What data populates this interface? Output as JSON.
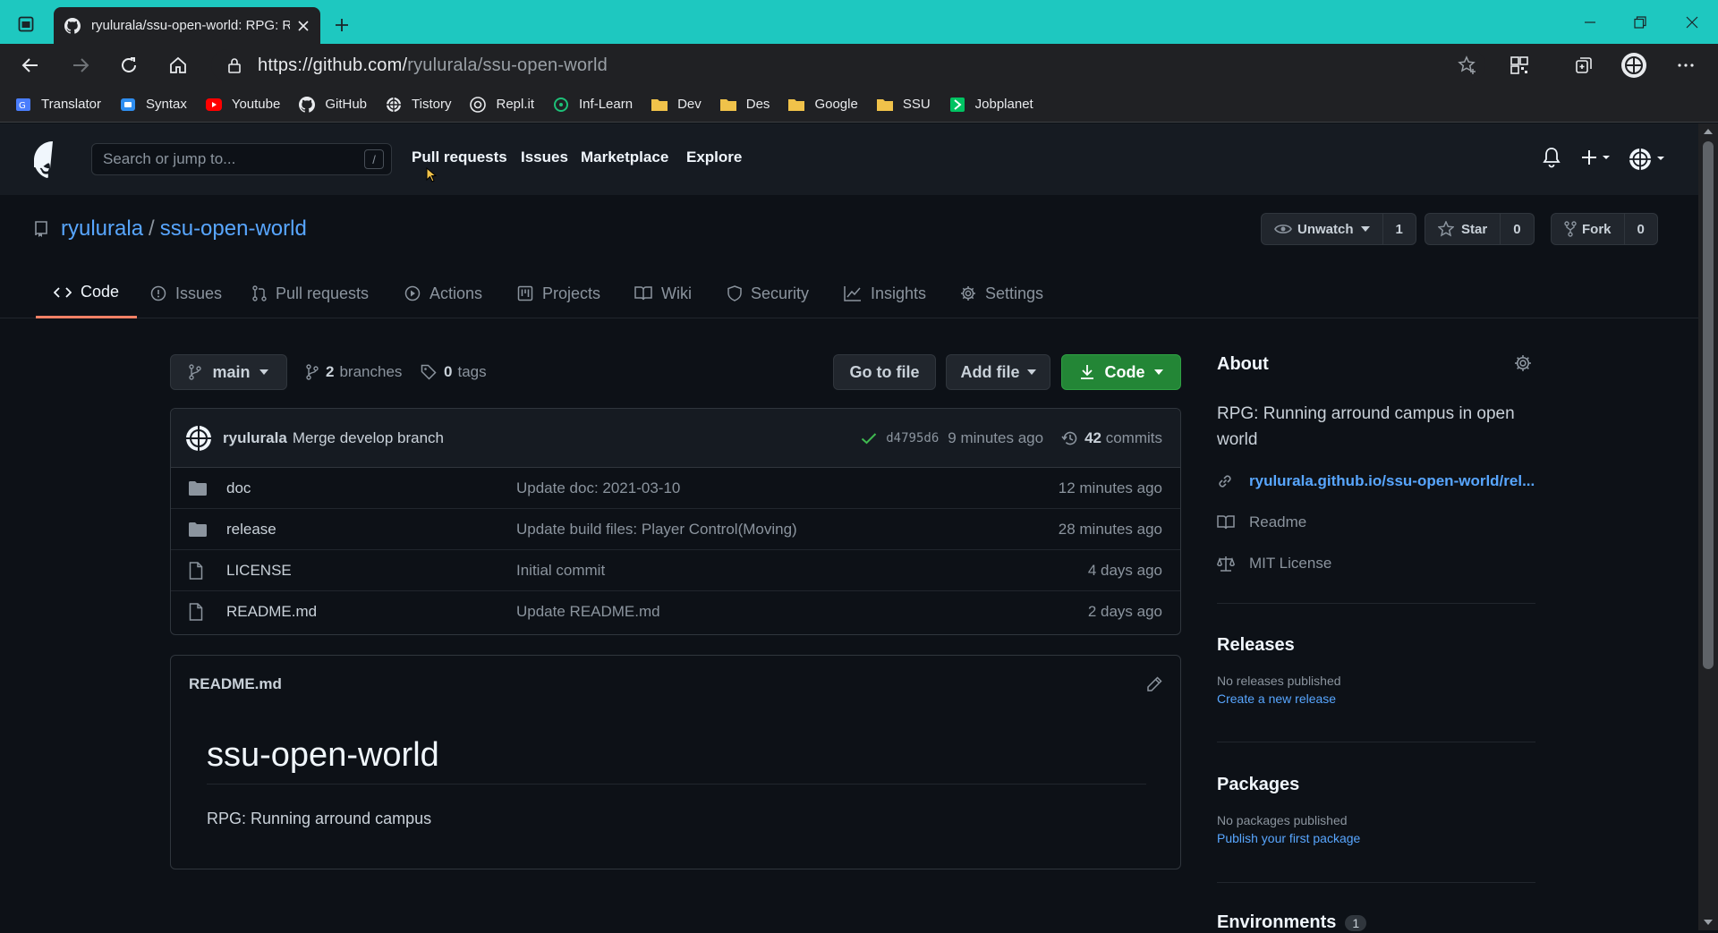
{
  "browser": {
    "tab_title": "ryulurala/ssu-open-world: RPG: Running arround campus",
    "url_host": "https://github.com/",
    "url_path": "ryulurala/ssu-open-world",
    "bookmarks": [
      "Translator",
      "Syntax",
      "Youtube",
      "GitHub",
      "Tistory",
      "Repl.it",
      "Inf-Learn",
      "Dev",
      "Des",
      "Google",
      "SSU",
      "Jobplanet"
    ]
  },
  "github_header": {
    "search_placeholder": "Search or jump to...",
    "search_shortcut": "/",
    "nav": [
      "Pull requests",
      "Issues",
      "Marketplace",
      "Explore"
    ]
  },
  "repo": {
    "owner": "ryulurala",
    "separator": "/",
    "name": "ssu-open-world",
    "watch_label": "Unwatch",
    "watch_count": "1",
    "star_label": "Star",
    "star_count": "0",
    "fork_label": "Fork",
    "fork_count": "0"
  },
  "repo_tabs": [
    "Code",
    "Issues",
    "Pull requests",
    "Actions",
    "Projects",
    "Wiki",
    "Security",
    "Insights",
    "Settings"
  ],
  "toolbar": {
    "branch": "main",
    "branches_count": "2",
    "branches_label": "branches",
    "tags_count": "0",
    "tags_label": "tags",
    "go_to_file": "Go to file",
    "add_file": "Add file",
    "code": "Code"
  },
  "latest_commit": {
    "author": "ryulurala",
    "message": "Merge develop branch",
    "sha": "d4795d6",
    "time": "9 minutes ago",
    "commits_count": "42",
    "commits_label": "commits"
  },
  "files": [
    {
      "type": "folder",
      "name": "doc",
      "message": "Update doc: 2021-03-10",
      "age": "12 minutes ago"
    },
    {
      "type": "folder",
      "name": "release",
      "message": "Update build files: Player Control(Moving)",
      "age": "28 minutes ago"
    },
    {
      "type": "file",
      "name": "LICENSE",
      "message": "Initial commit",
      "age": "4 days ago"
    },
    {
      "type": "file",
      "name": "README.md",
      "message": "Update README.md",
      "age": "2 days ago"
    }
  ],
  "readme": {
    "filename": "README.md",
    "heading": "ssu-open-world",
    "text": "RPG: Running arround campus"
  },
  "about": {
    "title": "About",
    "description": "RPG: Running arround campus in open world",
    "link": "ryulurala.github.io/ssu-open-world/rel...",
    "readme_label": "Readme",
    "license_label": "MIT License"
  },
  "releases": {
    "title": "Releases",
    "none_text": "No releases published",
    "create_link": "Create a new release"
  },
  "packages": {
    "title": "Packages",
    "none_text": "No packages published",
    "publish_link": "Publish your first package"
  },
  "environments": {
    "title": "Environments",
    "count": "1"
  },
  "colors": {
    "accent_link": "#58a6ff",
    "tab_underline": "#f78166",
    "green_button": "#238636",
    "titlebar": "#1ec8c0"
  }
}
